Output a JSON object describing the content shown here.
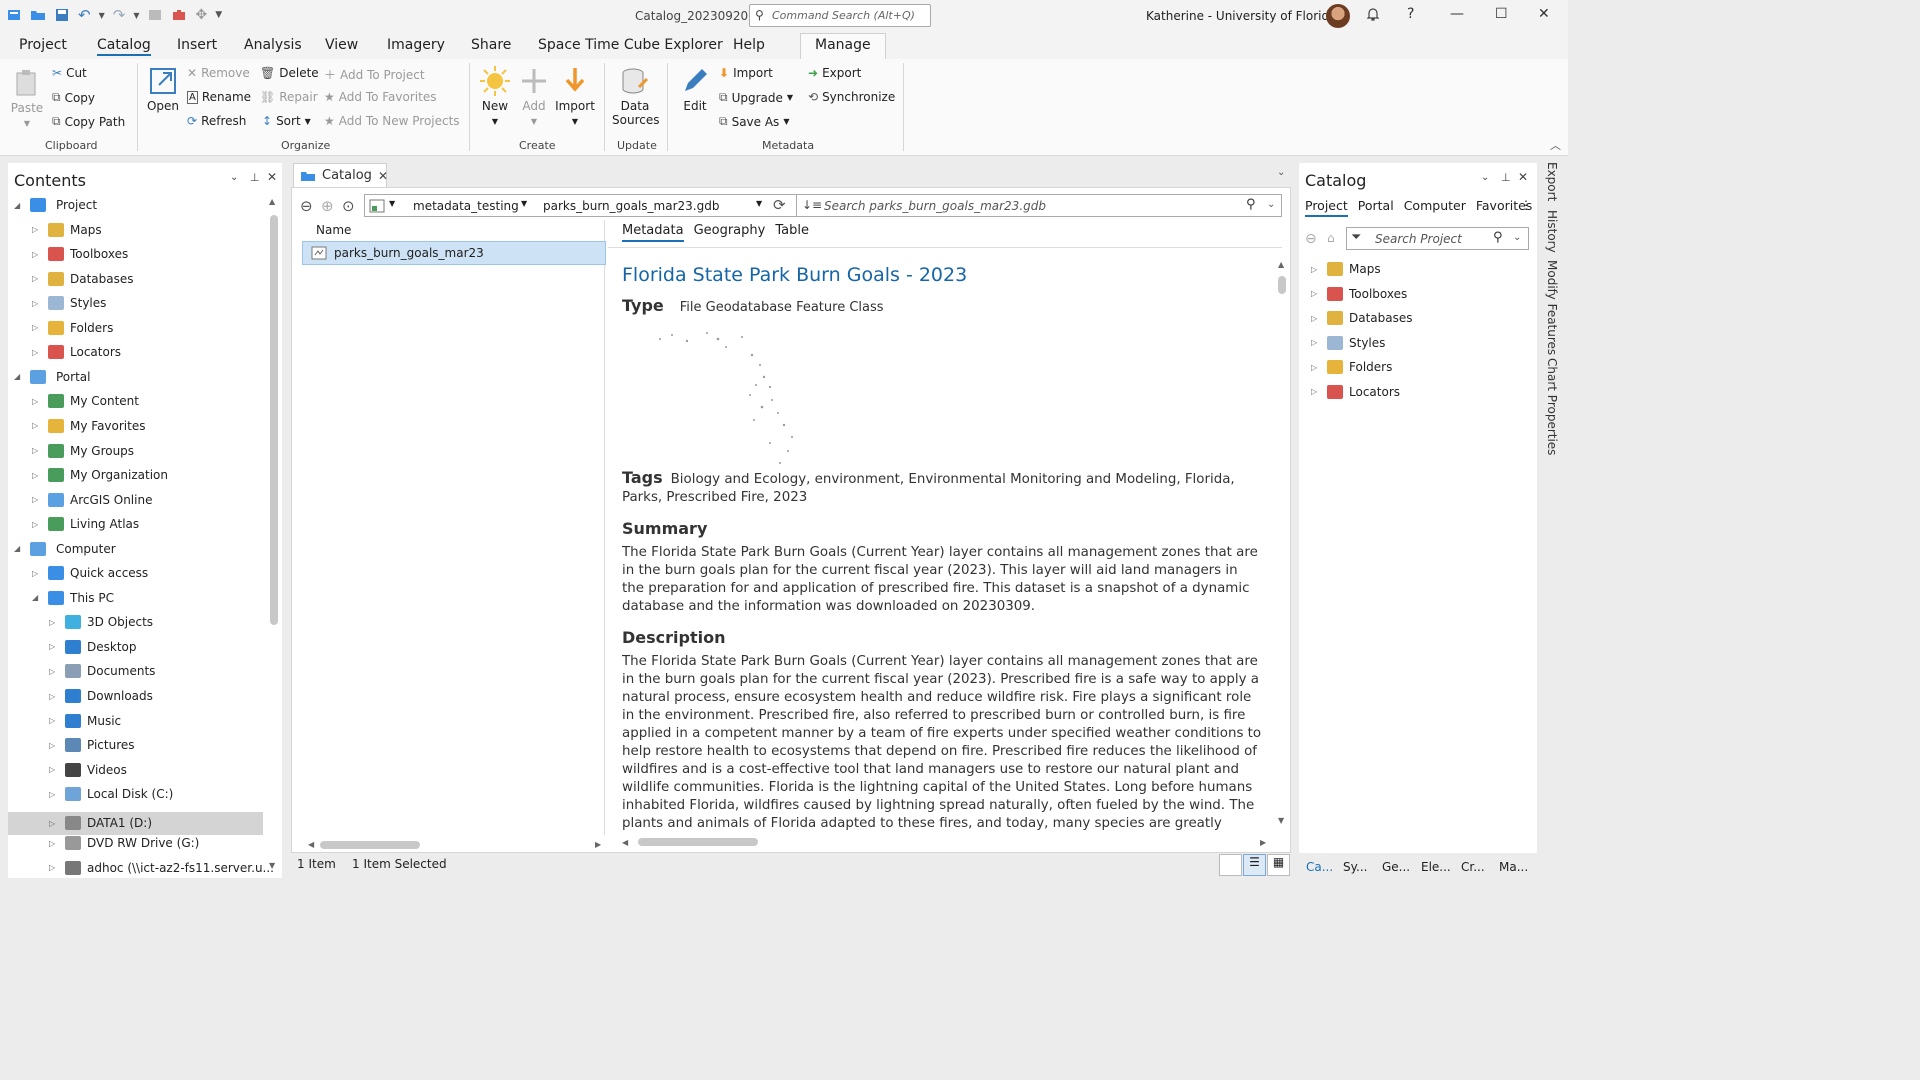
{
  "window": {
    "doc_title": "Catalog_20230920",
    "command_search_placeholder": "Command Search (Alt+Q)",
    "user": "Katherine - University of Florida",
    "notify_icon": "bell-icon",
    "help": "?"
  },
  "menu": {
    "tabs": [
      "Project",
      "Catalog",
      "Insert",
      "Analysis",
      "View",
      "Imagery",
      "Share",
      "Space Time Cube Explorer",
      "Help",
      "Manage"
    ]
  },
  "ribbon": {
    "clipboard": {
      "paste": "Paste",
      "cut": "Cut",
      "copy": "Copy",
      "copy_path": "Copy Path",
      "group": "Clipboard"
    },
    "organize": {
      "open": "Open",
      "remove": "Remove",
      "rename": "Rename",
      "refresh": "Refresh",
      "delete": "Delete",
      "repair": "Repair",
      "sort": "Sort",
      "add_to_project": "Add To Project",
      "add_to_favorites": "Add To Favorites",
      "add_to_new_projects": "Add To New Projects",
      "group": "Organize"
    },
    "create": {
      "new": "New",
      "add": "Add",
      "import": "Import",
      "group": "Create"
    },
    "update": {
      "data_sources_1": "Data",
      "data_sources_2": "Sources",
      "group": "Update"
    },
    "metadata": {
      "edit": "Edit",
      "import": "Import",
      "upgrade": "Upgrade",
      "save_as": "Save As",
      "export": "Export",
      "synchronize": "Synchronize",
      "group": "Metadata"
    }
  },
  "contents": {
    "title": "Contents",
    "items": [
      {
        "label": "Project",
        "level": 0,
        "open": true,
        "icon": "project-icon",
        "color": "#3a8ee6"
      },
      {
        "label": "Maps",
        "level": 1,
        "icon": "maps-icon",
        "color": "#e0b341"
      },
      {
        "label": "Toolboxes",
        "level": 1,
        "icon": "toolbox-icon",
        "color": "#d9534f"
      },
      {
        "label": "Databases",
        "level": 1,
        "icon": "database-icon",
        "color": "#e0b341"
      },
      {
        "label": "Styles",
        "level": 1,
        "icon": "styles-icon",
        "color": "#9bb7d4"
      },
      {
        "label": "Folders",
        "level": 1,
        "icon": "folder-icon",
        "color": "#e6b43b"
      },
      {
        "label": "Locators",
        "level": 1,
        "icon": "locator-icon",
        "color": "#d9534f"
      },
      {
        "label": "Portal",
        "level": 0,
        "open": true,
        "icon": "portal-icon",
        "color": "#5ba0e0"
      },
      {
        "label": "My Content",
        "level": 1,
        "icon": "my-content-icon",
        "color": "#4a9c5c"
      },
      {
        "label": "My Favorites",
        "level": 1,
        "icon": "favorites-icon",
        "color": "#e6b43b"
      },
      {
        "label": "My Groups",
        "level": 1,
        "icon": "groups-icon",
        "color": "#4a9c5c"
      },
      {
        "label": "My Organization",
        "level": 1,
        "icon": "organization-icon",
        "color": "#4a9c5c"
      },
      {
        "label": "ArcGIS Online",
        "level": 1,
        "icon": "cloud-icon",
        "color": "#5ba0e0"
      },
      {
        "label": "Living Atlas",
        "level": 1,
        "icon": "atlas-icon",
        "color": "#4a9c5c"
      },
      {
        "label": "Computer",
        "level": 0,
        "open": true,
        "icon": "computer-icon",
        "color": "#5ba0e0"
      },
      {
        "label": "Quick access",
        "level": 1,
        "icon": "star-icon",
        "color": "#3a8ee6"
      },
      {
        "label": "This PC",
        "level": 1,
        "open": true,
        "icon": "pc-icon",
        "color": "#3a8ee6"
      },
      {
        "label": "3D Objects",
        "level": 2,
        "icon": "cube-icon",
        "color": "#3fb0e0"
      },
      {
        "label": "Desktop",
        "level": 2,
        "icon": "desktop-icon",
        "color": "#2f7fd1"
      },
      {
        "label": "Documents",
        "level": 2,
        "icon": "documents-icon",
        "color": "#8a9fb5"
      },
      {
        "label": "Downloads",
        "level": 2,
        "icon": "download-icon",
        "color": "#2f7fd1"
      },
      {
        "label": "Music",
        "level": 2,
        "icon": "music-icon",
        "color": "#2f7fd1"
      },
      {
        "label": "Pictures",
        "level": 2,
        "icon": "pictures-icon",
        "color": "#5b88b5"
      },
      {
        "label": "Videos",
        "level": 2,
        "icon": "videos-icon",
        "color": "#444"
      },
      {
        "label": "Local Disk (C:)",
        "level": 2,
        "icon": "disk-icon",
        "color": "#6fa4d8"
      },
      {
        "label": "DATA1 (D:)",
        "level": 2,
        "icon": "drive-icon",
        "color": "#888",
        "selected": true
      },
      {
        "label": "DVD RW Drive (G:)",
        "level": 2,
        "icon": "dvd-icon",
        "color": "#999"
      },
      {
        "label": "adhoc (\\\\ict-az2-fs11.server.u...",
        "level": 2,
        "icon": "network-drive-icon",
        "color": "#777"
      }
    ]
  },
  "catalog_view": {
    "tab_label": "Catalog",
    "location1": "metadata_testing",
    "location2": "parks_burn_goals_mar23.gdb",
    "search_placeholder": "Search parks_burn_goals_mar23.gdb",
    "column_name": "Name",
    "item": "parks_burn_goals_mar23",
    "detail_tabs": [
      "Metadata",
      "Geography",
      "Table"
    ],
    "status_items": "1 Item",
    "status_selected": "1 Item Selected"
  },
  "metadata": {
    "title": "Florida State Park Burn Goals - 2023",
    "type_label": "Type",
    "type_value": "File Geodatabase Feature Class",
    "tags_label": "Tags",
    "tags_value": "Biology and Ecology, environment, Environmental Monitoring and Modeling, Florida, Parks, Prescribed Fire, 2023",
    "summary_label": "Summary",
    "summary": "The Florida State Park Burn Goals (Current Year) layer contains all management zones that are in the burn goals plan for the current fiscal year (2023). This layer will aid land managers in the preparation for and application of prescribed fire. This dataset is a snapshot of a dynamic database and the information was downloaded on 20230309.",
    "description_label": "Description",
    "description": "The Florida State Park Burn Goals (Current Year) layer contains all management zones that are in the burn goals plan for the current fiscal year (2023). Prescribed fire is a safe way to apply a natural process, ensure ecosystem health and reduce wildfire risk. Fire plays a significant role in the environment. Prescribed fire, also referred to prescribed burn or controlled burn, is fire applied in a competent manner by a team of fire experts under specified weather conditions to help restore health to ecosystems that depend on fire. Prescribed fire reduces the likelihood of wildfires and is a cost-effective tool that land managers use to restore our natural plant and wildlife communities. Florida is the lightning capital of the United States. Long before humans inhabited Florida, wildfires caused by lightning spread naturally, often fueled by the wind. The plants and animals of Florida adapted to these fires, and today, many species are greatly dependent on fire for survival. Today, wildfires are seen as a threat and are typically extinguished. This"
  },
  "catalog_pane": {
    "title": "Catalog",
    "tabs": [
      "Project",
      "Portal",
      "Computer",
      "Favorites"
    ],
    "search_placeholder": "Search Project",
    "items": [
      {
        "label": "Maps",
        "icon": "maps-icon",
        "color": "#e0b341"
      },
      {
        "label": "Toolboxes",
        "icon": "toolbox-icon",
        "color": "#d9534f"
      },
      {
        "label": "Databases",
        "icon": "database-icon",
        "color": "#e0b341"
      },
      {
        "label": "Styles",
        "icon": "styles-icon",
        "color": "#9bb7d4"
      },
      {
        "label": "Folders",
        "icon": "folder-icon",
        "color": "#e6b43b"
      },
      {
        "label": "Locators",
        "icon": "locator-icon",
        "color": "#d9534f"
      }
    ],
    "bottom_tabs": [
      "Ca...",
      "Sy...",
      "Ge...",
      "Ele...",
      "Cr...",
      "Ma..."
    ]
  },
  "side_tabs": [
    "Export",
    "History",
    "Modify Features",
    "Chart Properties"
  ],
  "colors": {
    "accent": "#1a6fb5",
    "title_blue": "#1565a8",
    "selection": "#cde3f5"
  }
}
